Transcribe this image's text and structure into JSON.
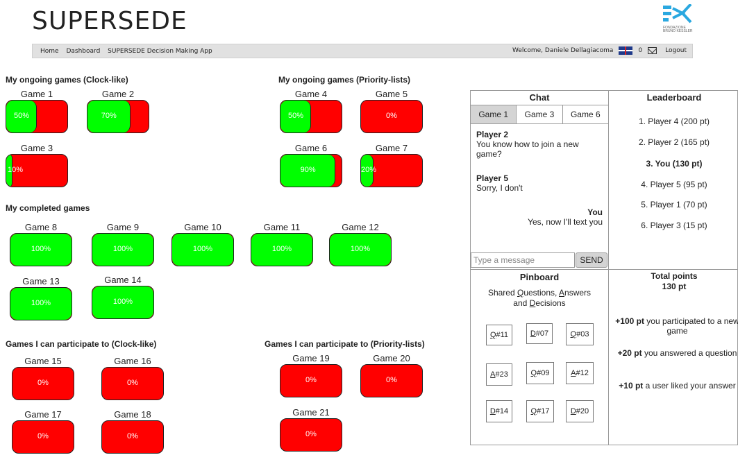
{
  "header": {
    "logo_text": "SUPERSEDE",
    "fbk_caption": "FONDAZIONE BRUNO KESSLER"
  },
  "nav": {
    "home": "Home",
    "dashboard": "Dashboard",
    "app": "SUPERSEDE Decision Making App",
    "welcome": "Welcome, Daniele Dellagiacoma",
    "msg_count": "0",
    "logout": "Logout"
  },
  "sections": {
    "ongoing_clock": "My ongoing games (Clock-like)",
    "ongoing_priority": "My ongoing games (Priority-lists)",
    "completed": "My completed games",
    "participate_clock": "Games I can participate to (Clock-like)",
    "participate_priority": "Games I can participate to (Priority-lists)"
  },
  "games": {
    "g1": {
      "label": "Game 1",
      "pct": "50%",
      "progress": 0.5
    },
    "g2": {
      "label": "Game 2",
      "pct": "70%",
      "progress": 0.7
    },
    "g3": {
      "label": "Game 3",
      "pct": "10%",
      "progress": 0.1
    },
    "g4": {
      "label": "Game 4",
      "pct": "50%",
      "progress": 0.5
    },
    "g5": {
      "label": "Game 5",
      "pct": "0%",
      "progress": 0
    },
    "g6": {
      "label": "Game 6",
      "pct": "90%",
      "progress": 0.9
    },
    "g7": {
      "label": "Game 7",
      "pct": "20%",
      "progress": 0.2
    },
    "g8": {
      "label": "Game 8",
      "pct": "100%",
      "progress": 1
    },
    "g9": {
      "label": "Game 9",
      "pct": "100%",
      "progress": 1
    },
    "g10": {
      "label": "Game 10",
      "pct": "100%",
      "progress": 1
    },
    "g11": {
      "label": "Game 11",
      "pct": "100%",
      "progress": 1
    },
    "g12": {
      "label": "Game 12",
      "pct": "100%",
      "progress": 1
    },
    "g13": {
      "label": "Game 13",
      "pct": "100%",
      "progress": 1
    },
    "g14": {
      "label": "Game 14",
      "pct": "100%",
      "progress": 1
    },
    "g15": {
      "label": "Game 15",
      "pct": "0%",
      "progress": 0
    },
    "g16": {
      "label": "Game 16",
      "pct": "0%",
      "progress": 0
    },
    "g17": {
      "label": "Game 17",
      "pct": "0%",
      "progress": 0
    },
    "g18": {
      "label": "Game 18",
      "pct": "0%",
      "progress": 0
    },
    "g19": {
      "label": "Game 19",
      "pct": "0%",
      "progress": 0
    },
    "g20": {
      "label": "Game 20",
      "pct": "0%",
      "progress": 0
    },
    "g21": {
      "label": "Game 21",
      "pct": "0%",
      "progress": 0
    }
  },
  "chat": {
    "title": "Chat",
    "tabs": [
      "Game 1",
      "Game 3",
      "Game 6"
    ],
    "messages": [
      {
        "who": "Player 2",
        "text": "You know how to join a new game?"
      },
      {
        "who": "Player 5",
        "text": "Sorry, I don't"
      },
      {
        "who": "You",
        "text": "Yes, now I'll text you"
      }
    ],
    "placeholder": "Type a message",
    "send": "SEND"
  },
  "leaderboard": {
    "title": "Leaderboard",
    "items": [
      "1. Player 4 (200 pt)",
      "2. Player 2 (165 pt)",
      "3. You (130 pt)",
      "4. Player 5 (95 pt)",
      "5. Player 1 (70 pt)",
      "6. Player 3 (15 pt)"
    ]
  },
  "pinboard": {
    "title": "Pinboard",
    "sub1": "Shared ",
    "q": "Q",
    "sub2": "uestions, ",
    "a": "A",
    "sub3": "nswers",
    "sub4": "and ",
    "d": "D",
    "sub5": "ecisions",
    "cards": [
      {
        "p": "Q",
        "n": "#11"
      },
      {
        "p": "D",
        "n": "#07"
      },
      {
        "p": "Q",
        "n": "#03"
      },
      {
        "p": "A",
        "n": "#23"
      },
      {
        "p": "Q",
        "n": "#09"
      },
      {
        "p": "A",
        "n": "#12"
      },
      {
        "p": "D",
        "n": "#14"
      },
      {
        "p": "Q",
        "n": "#17"
      },
      {
        "p": "D",
        "n": "#20"
      }
    ]
  },
  "points": {
    "title": "Total points",
    "value": "130 pt",
    "items": [
      {
        "b": "+100 pt",
        "t": " you participated to a new game"
      },
      {
        "b": "+20 pt",
        "t": " you answered a question"
      },
      {
        "b": "+10 pt",
        "t": " a user liked your answer"
      }
    ]
  },
  "colors": {
    "progress": "#00ff00",
    "remaining": "#ff0000",
    "nav_bg": "#e1e1e1"
  },
  "icons": {
    "flag": "uk-flag-icon",
    "mail": "mail-icon"
  }
}
